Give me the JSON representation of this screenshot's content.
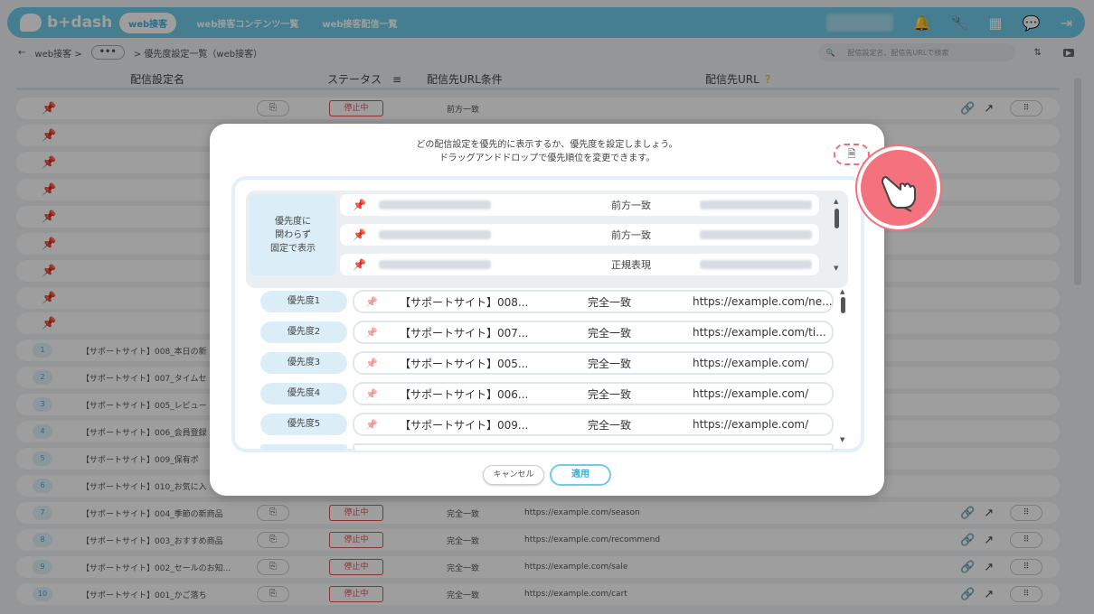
{
  "app": {
    "logo_text": "b+dash"
  },
  "topbar": {
    "active_tab": "web接客",
    "nav": [
      "web接客コンテンツ一覧",
      "web接客配信一覧"
    ]
  },
  "breadcrumb": {
    "back": "←",
    "root": "web接客 >",
    "ellipsis": "•••",
    "current": "> 優先度設定一覧（web接客）"
  },
  "search": {
    "placeholder": "配信設定名、配信先URLで検索"
  },
  "table": {
    "headers": {
      "name": "配信設定名",
      "status": "ステータス",
      "condition": "配信先URL条件",
      "url": "配信先URL"
    },
    "rows": [
      {
        "num": "7",
        "name": "【サポートサイト】004_季節の新商品",
        "status": "停止中",
        "condition": "完全一致",
        "url": "https://example.com/season"
      },
      {
        "num": "8",
        "name": "【サポートサイト】003_おすすめ商品",
        "status": "停止中",
        "condition": "完全一致",
        "url": "https://example.com/recommend"
      },
      {
        "num": "9",
        "name": "【サポートサイト】002_セールのお知...",
        "status": "停止中",
        "condition": "完全一致",
        "url": "https://example.com/sale"
      },
      {
        "num": "10",
        "name": "【サポートサイト】001_かご落ち",
        "status": "停止中",
        "condition": "完全一致",
        "url": "https://example.com/cart"
      }
    ],
    "row1": {
      "status": "停止中",
      "condition": "前方一致"
    },
    "left_rows": [
      {
        "num": "1",
        "name": "【サポートサイト】008_本日の新"
      },
      {
        "num": "2",
        "name": "【サポートサイト】007_タイムセ"
      },
      {
        "num": "3",
        "name": "【サポートサイト】005_レビュー"
      },
      {
        "num": "4",
        "name": "【サポートサイト】006_会員登録"
      },
      {
        "num": "5",
        "name": "【サポートサイト】009_保有ポ"
      },
      {
        "num": "6",
        "name": "【サポートサイト】010_お気に入"
      }
    ]
  },
  "modal": {
    "message_line1": "どの配信設定を優先的に表示するか、優先度を設定しましょう。",
    "message_line2": "ドラッグアンドドロップで優先順位を変更できます。",
    "fixed_label": "優先度に\n関わらず\n固定で表示",
    "fixed_rows": [
      {
        "condition": "前方一致"
      },
      {
        "condition": "前方一致"
      },
      {
        "condition": "正規表現"
      }
    ],
    "priority_rows": [
      {
        "label": "優先度1",
        "name": "【サポートサイト】008...",
        "condition": "完全一致",
        "url": "https://example.com/ne..."
      },
      {
        "label": "優先度2",
        "name": "【サポートサイト】007...",
        "condition": "完全一致",
        "url": "https://example.com/ti..."
      },
      {
        "label": "優先度3",
        "name": "【サポートサイト】005...",
        "condition": "完全一致",
        "url": "https://example.com/"
      },
      {
        "label": "優先度4",
        "name": "【サポートサイト】006...",
        "condition": "完全一致",
        "url": "https://example.com/"
      },
      {
        "label": "優先度5",
        "name": "【サポートサイト】009...",
        "condition": "完全一致",
        "url": "https://example.com/"
      }
    ],
    "cancel_label": "キャンセル",
    "apply_label": "適用"
  },
  "colors": {
    "accent": "#6ecbe9",
    "stop": "#e05050",
    "hand": "#f3727e"
  }
}
